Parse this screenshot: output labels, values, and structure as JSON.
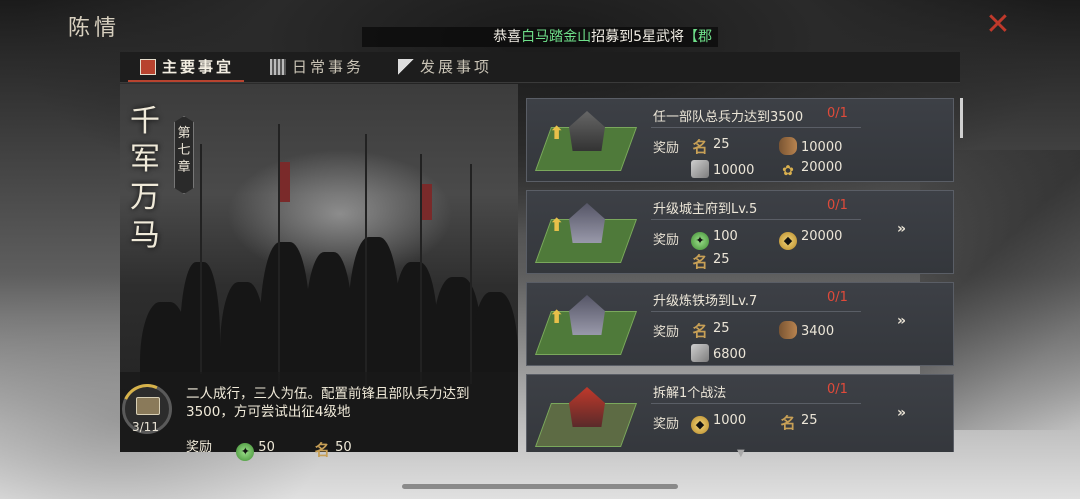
{
  "window": {
    "title": "陈情",
    "ticker": {
      "prefix": "恭喜",
      "highlight": "白马踏金山",
      "middle": "招募到5星武将",
      "suffix": "【郡"
    }
  },
  "tabs": [
    {
      "label": "主要事宜",
      "active": true
    },
    {
      "label": "日常事务",
      "active": false
    },
    {
      "label": "发展事项",
      "active": false
    }
  ],
  "chapter": {
    "name_chars": [
      "千",
      "军",
      "万",
      "马"
    ],
    "tag_chars": [
      "第",
      "七",
      "章"
    ],
    "progress": "3/11",
    "description": "二人成行，三人为伍。配置前锋且部队兵力达到3500，方可尝试出征4级地",
    "reward_label": "奖励",
    "rewards": [
      {
        "icon": "jade-icon",
        "value": "50"
      },
      {
        "icon": "name-token-icon",
        "value": "50"
      }
    ]
  },
  "tasks": [
    {
      "title": "任一部队总兵力达到3500",
      "count": "0/1",
      "reward_label": "奖励",
      "rewards": [
        {
          "icon": "name-token-icon",
          "value": "25"
        },
        {
          "icon": "wood-icon",
          "value": "10000"
        },
        {
          "icon": "iron-icon",
          "value": "10000"
        },
        {
          "icon": "grain-icon",
          "value": "20000"
        }
      ],
      "go": ""
    },
    {
      "title": "升级城主府到Lv.5",
      "count": "0/1",
      "reward_label": "奖励",
      "rewards": [
        {
          "icon": "jade-icon",
          "value": "100"
        },
        {
          "icon": "coin-icon",
          "value": "20000"
        },
        {
          "icon": "name-token-icon",
          "value": "25"
        }
      ],
      "go": "»"
    },
    {
      "title": "升级炼铁场到Lv.7",
      "count": "0/1",
      "reward_label": "奖励",
      "rewards": [
        {
          "icon": "name-token-icon",
          "value": "25"
        },
        {
          "icon": "wood-icon",
          "value": "3400"
        },
        {
          "icon": "iron-icon",
          "value": "6800"
        }
      ],
      "go": "»"
    },
    {
      "title": "拆解1个战法",
      "count": "0/1",
      "reward_label": "奖励",
      "rewards": [
        {
          "icon": "coin-icon",
          "value": "1000"
        },
        {
          "icon": "name-token-icon",
          "value": "25"
        }
      ],
      "go": "»"
    }
  ],
  "colors": {
    "accent_red": "#b8432f",
    "count_red": "#e04a3a",
    "ticker_green": "#6fe08a"
  }
}
